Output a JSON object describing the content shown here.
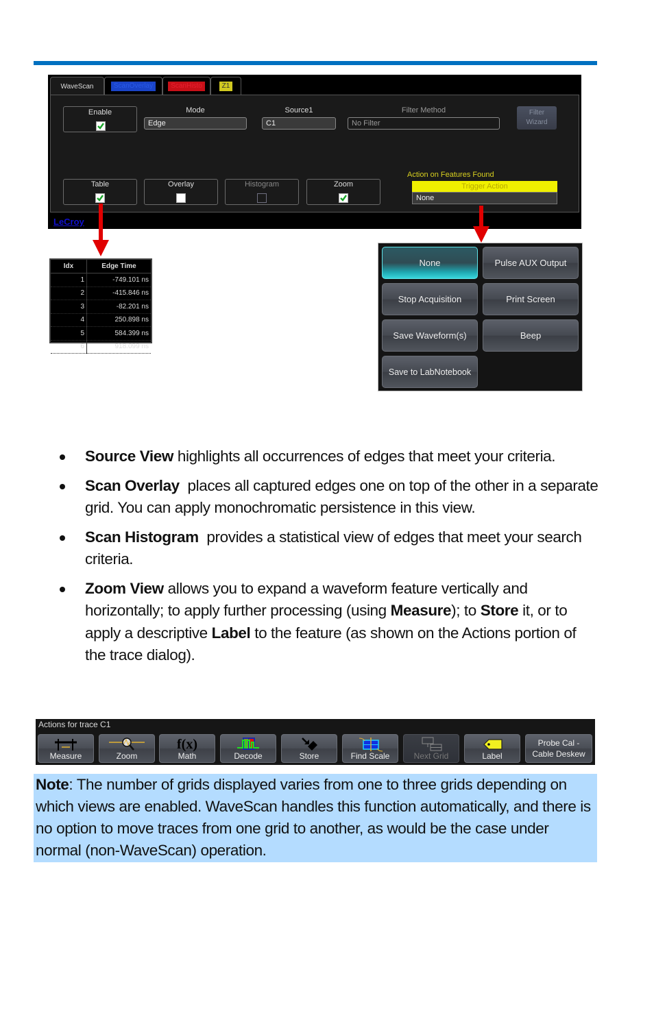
{
  "dialog": {
    "tabs": [
      {
        "label": "WaveScan",
        "active": true
      },
      {
        "label": "ScanOverlay",
        "color": "#1a44c8"
      },
      {
        "label": "ScanHisto",
        "color": "#d0101a"
      },
      {
        "label": "Z1",
        "color": "#d8d020"
      }
    ],
    "enable": {
      "label": "Enable",
      "checked": true
    },
    "mode": {
      "label": "Mode",
      "value": "Edge"
    },
    "source1": {
      "label": "Source1",
      "value": "C1"
    },
    "filter_method": {
      "label": "Filter Method",
      "value": "No Filter"
    },
    "filter_wizard": {
      "line1": "Filter",
      "line2": "Wizard"
    },
    "views": [
      {
        "label": "Table",
        "checked": true,
        "enabled": true
      },
      {
        "label": "Overlay",
        "checked": false,
        "enabled": true
      },
      {
        "label": "Histogram",
        "checked": false,
        "enabled": false
      },
      {
        "label": "Zoom",
        "checked": true,
        "enabled": true
      }
    ],
    "action_on_features": {
      "label": "Action on Features Found",
      "header": "Trigger Action",
      "value": "None"
    },
    "brand": "LeCroy"
  },
  "edge_table": {
    "columns": [
      "Idx",
      "Edge Time"
    ],
    "rows": [
      [
        "1",
        "-749.101 ns"
      ],
      [
        "2",
        "-415.846 ns"
      ],
      [
        "3",
        "-82.201 ns"
      ],
      [
        "4",
        "250.898 ns"
      ],
      [
        "5",
        "584.399 ns"
      ],
      [
        "6",
        "918.099 ns"
      ]
    ]
  },
  "trigger_actions": {
    "buttons": [
      {
        "label": "None",
        "selected": true
      },
      {
        "label": "Pulse AUX Output"
      },
      {
        "label": "Stop Acquisition"
      },
      {
        "label": "Print Screen"
      },
      {
        "label": "Save Waveform(s)"
      },
      {
        "label": "Beep"
      },
      {
        "label": "Save to LabNotebook"
      }
    ]
  },
  "bullets": [
    {
      "term": "Source View",
      "text": " highlights all occurrences of edges that meet your criteria."
    },
    {
      "term": "Scan Overlay",
      "text": "  places all captured edges one on top of the other in a separate grid. You can apply monochromatic persistence in this view."
    },
    {
      "term": "Scan Histogram",
      "text": "  provides a statistical view of edges that meet your search criteria."
    },
    {
      "term": "Zoom View",
      "parts": [
        " allows you to expand a waveform feature vertically and horizontally; to apply further processing (using ",
        "Measure",
        "); to ",
        "Store",
        " it, or to apply a descriptive ",
        "Label",
        " to the feature (as shown on the Actions portion of the trace dialog)."
      ]
    }
  ],
  "trace_actions": {
    "title": "Actions for trace C1",
    "buttons": [
      {
        "label": "Measure",
        "icon": "measure-icon"
      },
      {
        "label": "Zoom",
        "icon": "zoom-icon"
      },
      {
        "label": "Math",
        "icon": "math-icon",
        "glyph": "f(x)"
      },
      {
        "label": "Decode",
        "icon": "decode-icon"
      },
      {
        "label": "Store",
        "icon": "store-icon"
      },
      {
        "label": "Find Scale",
        "icon": "find-scale-icon"
      },
      {
        "label": "Next Grid",
        "icon": "next-grid-icon",
        "disabled": true
      },
      {
        "label": "Label",
        "icon": "label-icon"
      },
      {
        "line1": "Probe Cal -",
        "line2": "Cable Deskew"
      }
    ]
  },
  "note": {
    "term": "Note",
    "text": ": The number of grids displayed varies from one to three grids depending on which views are enabled. WaveScan handles this function automatically, and there is no option to move traces from one grid to another, as would be the case under normal (non-WaveScan) operation."
  }
}
